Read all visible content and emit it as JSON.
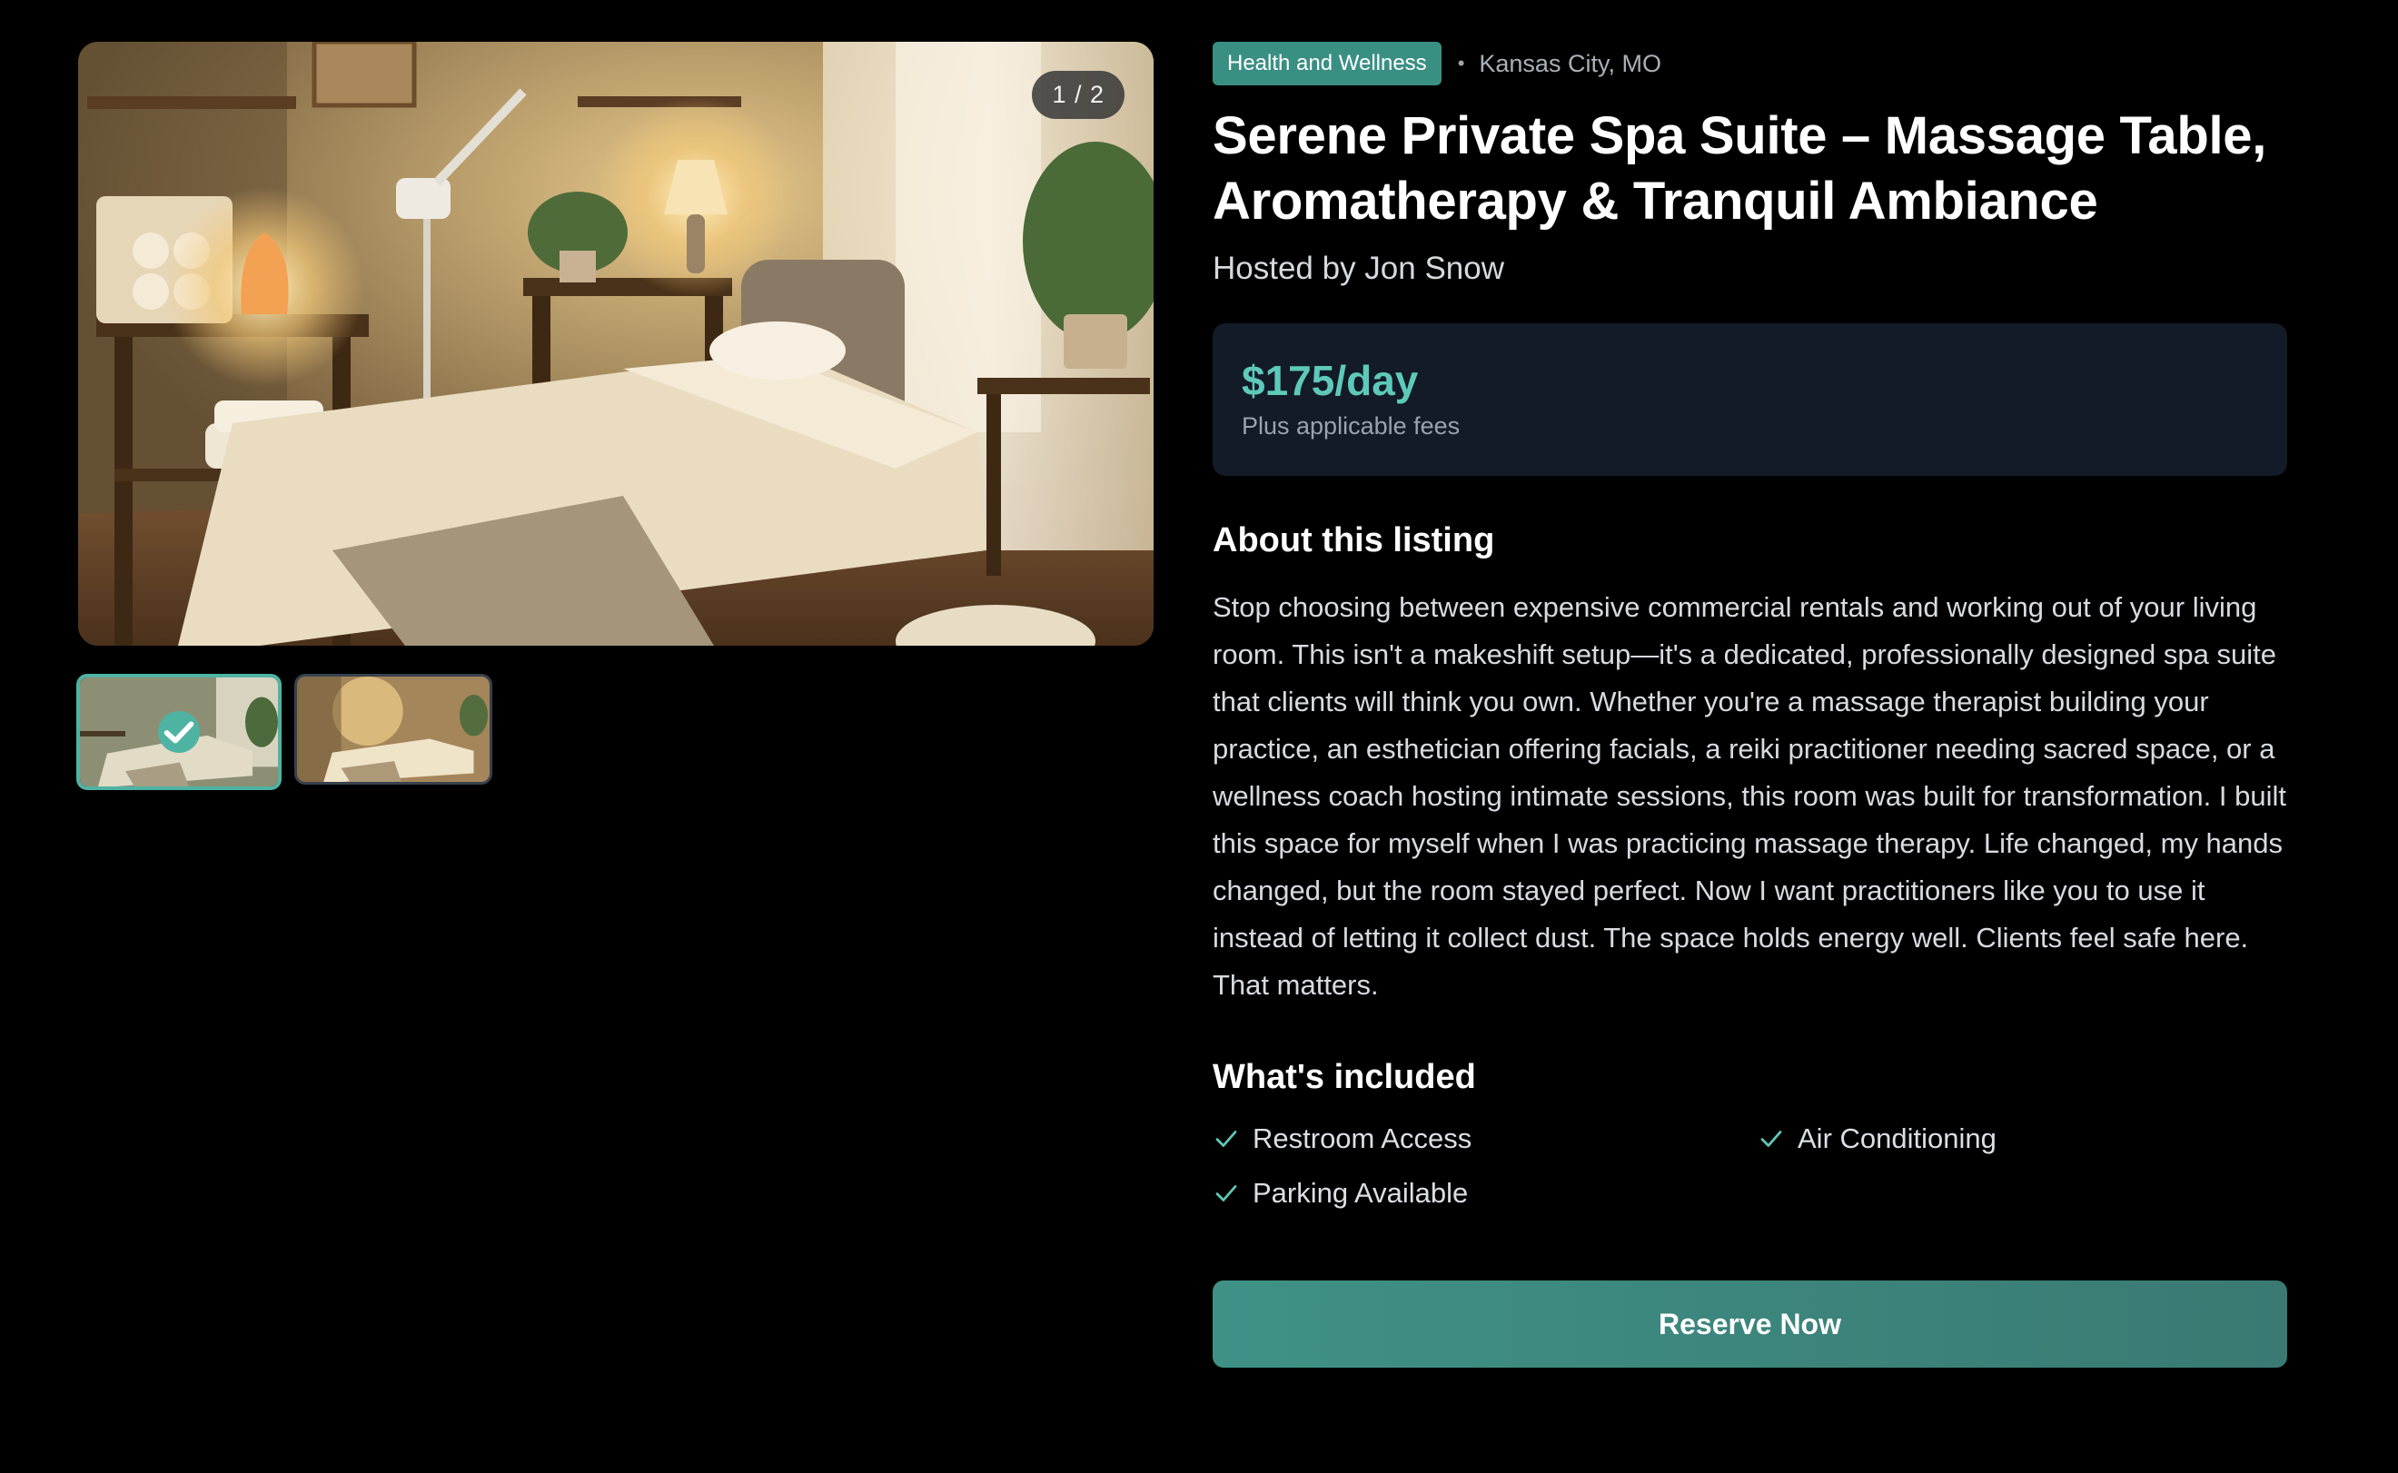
{
  "gallery": {
    "counter": "1 / 2",
    "photos": [
      {
        "icon": "massage-room-photo"
      },
      {
        "icon": "massage-room-photo-2"
      }
    ],
    "selected_icon": "checkmark-icon",
    "accent_color": "#4fb3a3"
  },
  "listing": {
    "category": "Health and Wellness",
    "location": "Kansas City, MO",
    "separator": "•",
    "title": "Serene Private Spa Suite – Massage Table, Aromatherapy & Tranquil Ambiance",
    "host": "Hosted by Jon Snow"
  },
  "pricing": {
    "price": "$175/day",
    "note": "Plus applicable fees",
    "price_color": "#5ec9b8"
  },
  "about": {
    "heading": "About this listing",
    "description": "Stop choosing between expensive commercial rentals and working out of your living room. This isn't a makeshift setup—it's a dedicated, professionally designed spa suite that clients will think you own. Whether you're a massage therapist building your practice, an esthetician offering facials, a reiki practitioner needing sacred space, or a wellness coach hosting intimate sessions, this room was built for transformation. I built this space for myself when I was practicing massage therapy. Life changed, my hands changed, but the room stayed perfect. Now I want practitioners like you to use it instead of letting it collect dust. The space holds energy well. Clients feel safe here. That matters."
  },
  "included": {
    "heading": "What's included",
    "items": [
      {
        "label": "Restroom Access",
        "icon": "check-icon"
      },
      {
        "label": "Air Conditioning",
        "icon": "check-icon"
      },
      {
        "label": "Parking Available",
        "icon": "check-icon"
      }
    ]
  },
  "actions": {
    "reserve_label": "Reserve Now",
    "button_color": "#3f9186"
  }
}
